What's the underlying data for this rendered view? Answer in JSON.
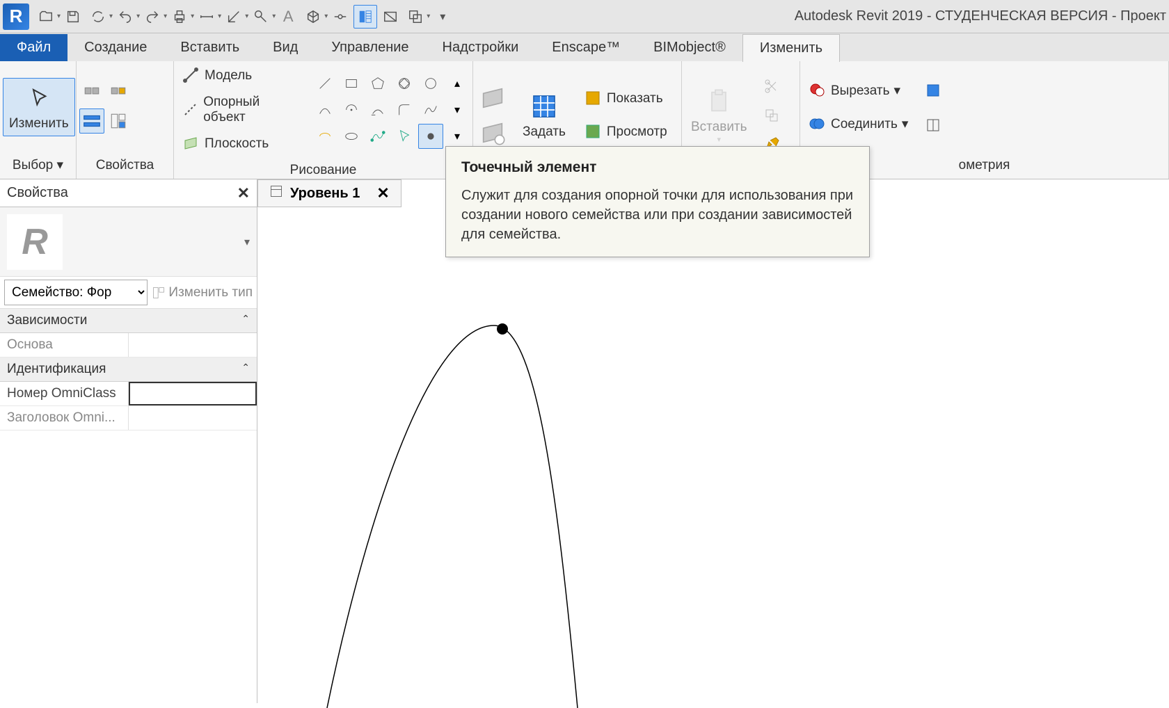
{
  "app_title": "Autodesk Revit 2019 - СТУДЕНЧЕСКАЯ ВЕРСИЯ - Проект",
  "tabs": {
    "file": "Файл",
    "items": [
      "Создание",
      "Вставить",
      "Вид",
      "Управление",
      "Надстройки",
      "Enscape™",
      "BIMobject®",
      "Изменить"
    ],
    "active": "Изменить"
  },
  "panels": {
    "select": {
      "modify": "Изменить",
      "label": "Выбор"
    },
    "props": {
      "label": "Свойства"
    },
    "draw": {
      "model": "Модель",
      "reference": "Опорный объект",
      "plane": "Плоскость",
      "label": "Рисование"
    },
    "workplane": {
      "set": "Задать",
      "show": "Показать",
      "viewer": "Просмотр"
    },
    "clipboard": {
      "paste": "Вставить"
    },
    "geometry": {
      "cut": "Вырезать",
      "join": "Соединить",
      "label": "ометрия"
    }
  },
  "tooltip": {
    "title": "Точечный элемент",
    "body": "Служит для создания опорной точки для использования при создании нового семейства или при создании зависимостей для семейства."
  },
  "properties": {
    "panel_title": "Свойства",
    "family_selector": "Семейство: Фор",
    "edit_type": "Изменить тип",
    "groups": {
      "constraints": "Зависимости",
      "identity": "Идентификация"
    },
    "rows": {
      "host": "Основа",
      "omni_num": "Номер OmniClass",
      "omni_title": "Заголовок Omni..."
    }
  },
  "view": {
    "tab": "Уровень 1"
  }
}
